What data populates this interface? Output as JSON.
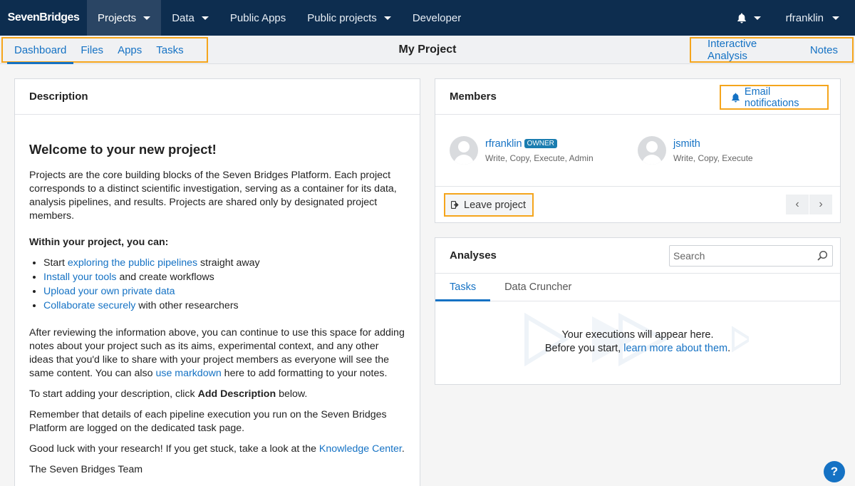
{
  "topbar": {
    "logo": "SevenBridges",
    "nav": [
      {
        "label": "Projects",
        "dropdown": true,
        "active": true
      },
      {
        "label": "Data",
        "dropdown": true
      },
      {
        "label": "Public Apps",
        "dropdown": false
      },
      {
        "label": "Public projects",
        "dropdown": true
      },
      {
        "label": "Developer",
        "dropdown": false
      }
    ],
    "user": "rfranklin",
    "bell_icon": "bell-icon",
    "background": "#0d2d4f"
  },
  "subbar": {
    "tabs": [
      "Dashboard",
      "Files",
      "Apps",
      "Tasks"
    ],
    "active_tab": "Dashboard",
    "title": "My Project",
    "right_links": [
      "Interactive Analysis",
      "Notes"
    ]
  },
  "description": {
    "header": "Description",
    "welcome": "Welcome to your new project!",
    "intro": "Projects are the core building blocks of the Seven Bridges Platform. Each project corresponds to a distinct scientific investigation, serving as a container for its data, analysis pipelines, and results. Projects are shared only by designated project members.",
    "within": "Within your project, you can:",
    "list": [
      {
        "pre": "Start ",
        "link": "exploring the public pipelines",
        "post": " straight away"
      },
      {
        "pre": "",
        "link": "Install your tools",
        "post": " and create workflows"
      },
      {
        "pre": "",
        "link": "Upload your own private data",
        "post": ""
      },
      {
        "pre": "",
        "link": "Collaborate securely",
        "post": " with other researchers"
      }
    ],
    "after_pre": "After reviewing the information above, you can continue to use this space for adding notes about your project such as its aims, experimental context, and any other ideas that you'd like to share with your project members as everyone will see the same content. You can also ",
    "after_link": "use markdown",
    "after_post": " here to add formatting to your notes.",
    "start_pre": "To start adding your description, click ",
    "start_bold": "Add Description",
    "start_post": " below.",
    "remember": "Remember that details of each pipeline execution you run on the Seven Bridges Platform are logged on the dedicated task page.",
    "luck_pre": "Good luck with your research! If you get stuck, take a look at the ",
    "luck_link": "Knowledge Center",
    "luck_post": ".",
    "signoff": "The Seven Bridges Team"
  },
  "members": {
    "header": "Members",
    "email_label": "Email notifications",
    "list": [
      {
        "name": "rfranklin",
        "badge": "OWNER",
        "perms": "Write, Copy, Execute, Admin"
      },
      {
        "name": "jsmith",
        "badge": "",
        "perms": "Write, Copy, Execute"
      }
    ],
    "leave_label": "Leave project",
    "prev": "‹",
    "next": "›"
  },
  "analyses": {
    "header": "Analyses",
    "search_placeholder": "Search",
    "tabs": [
      "Tasks",
      "Data Cruncher"
    ],
    "empty_line1": "Your executions will appear here.",
    "empty_line2_pre": "Before you start, ",
    "empty_link": "learn more about them",
    "empty_post": "."
  },
  "help": "?",
  "colors": {
    "accent": "#1572c4",
    "highlight": "#f5a51c"
  }
}
